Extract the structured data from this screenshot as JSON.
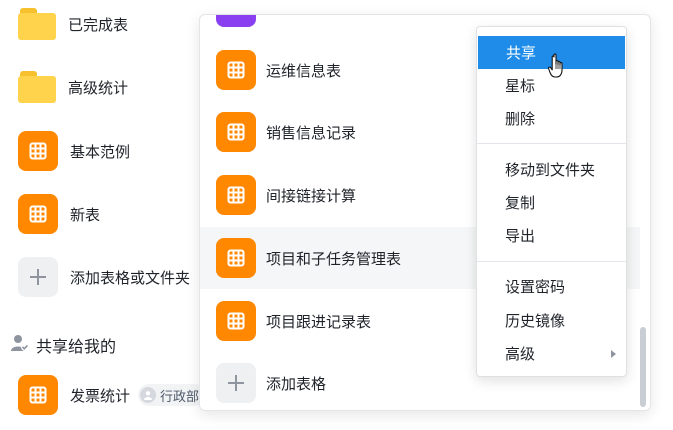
{
  "sidebar": {
    "items": [
      {
        "label": "已完成表",
        "icon": "folder-icon"
      },
      {
        "label": "高级统计",
        "icon": "folder-icon"
      },
      {
        "label": "基本范例",
        "icon": "sheet-icon"
      },
      {
        "label": "新表",
        "icon": "sheet-icon"
      },
      {
        "label": "添加表格或文件夹",
        "icon": "plus-icon"
      }
    ],
    "shared_section": {
      "title": "共享给我的",
      "icon": "shared-user-icon",
      "items": [
        {
          "label": "发票统计",
          "owner": "行政部",
          "icon": "sheet-icon"
        }
      ]
    }
  },
  "panel": {
    "rows": [
      {
        "label": "运维信息表",
        "icon": "sheet-icon"
      },
      {
        "label": "销售信息记录",
        "icon": "sheet-icon"
      },
      {
        "label": "间接链接计算",
        "icon": "sheet-icon"
      },
      {
        "label": "项目和子任务管理表",
        "icon": "sheet-icon"
      },
      {
        "label": "项目跟进记录表",
        "icon": "sheet-icon"
      },
      {
        "label": "添加表格",
        "icon": "plus-icon"
      }
    ]
  },
  "context_menu": {
    "groups": [
      [
        {
          "label": "共享"
        },
        {
          "label": "星标"
        },
        {
          "label": "删除"
        }
      ],
      [
        {
          "label": "移动到文件夹"
        },
        {
          "label": "复制"
        },
        {
          "label": "导出"
        }
      ],
      [
        {
          "label": "设置密码"
        },
        {
          "label": "历史镜像"
        },
        {
          "label": "高级",
          "submenu": true
        }
      ]
    ],
    "active_item": "共享"
  },
  "colors": {
    "sheet_orange": "#ff8800",
    "folder_yellow": "#ffd34c",
    "menu_highlight": "#1e8ce8",
    "purple_sheet": "#8a3ff0"
  }
}
